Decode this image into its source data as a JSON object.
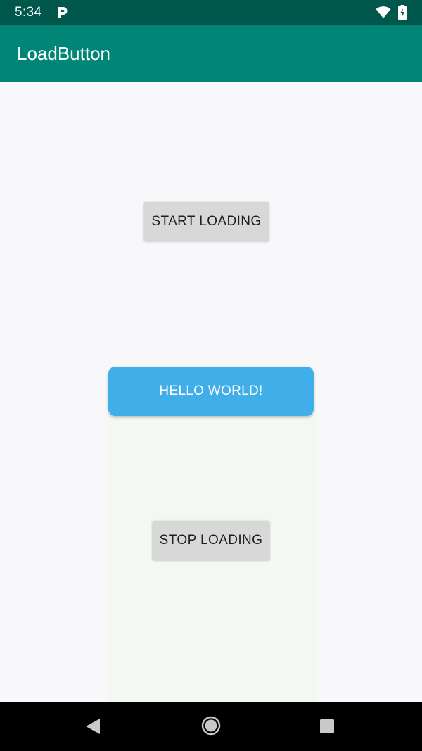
{
  "status_bar": {
    "time": "5:34",
    "notification_icon": "parking-p-icon",
    "wifi_icon": "wifi-icon",
    "battery_icon": "battery-charging-icon"
  },
  "app_bar": {
    "title": "LoadButton",
    "background_color": "#008577"
  },
  "main": {
    "start_button_label": "START LOADING",
    "load_button_label": "HELLO WORLD!",
    "stop_button_label": "STOP LOADING",
    "load_button_color": "#3faee9"
  },
  "navigation_bar": {
    "back_icon": "back-triangle-icon",
    "home_icon": "home-circle-icon",
    "recents_icon": "recents-square-icon"
  }
}
